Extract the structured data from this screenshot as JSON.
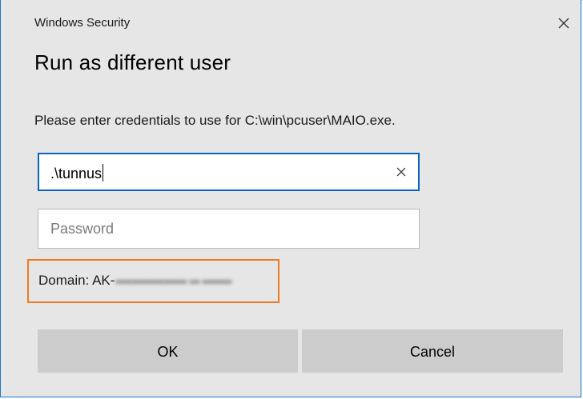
{
  "window": {
    "caption": "Windows Security",
    "close_icon": "close-icon"
  },
  "dialog": {
    "title": "Run as different user",
    "prompt": "Please enter credentials to use for C:\\win\\pcuser\\MAIO.exe."
  },
  "username": {
    "value": ".\\tunnus",
    "clear_icon": "clear-x-icon"
  },
  "password": {
    "value": "",
    "placeholder": "Password"
  },
  "domain": {
    "label": "Domain: AK-",
    "redacted": true
  },
  "buttons": {
    "ok_label": "OK",
    "cancel_label": "Cancel"
  },
  "colors": {
    "dialog_background": "#e6e6e6",
    "window_border": "#1979ca",
    "focused_field_border": "#0a64c2",
    "highlight_box": "#f07a26",
    "button_background": "#cccccc"
  }
}
